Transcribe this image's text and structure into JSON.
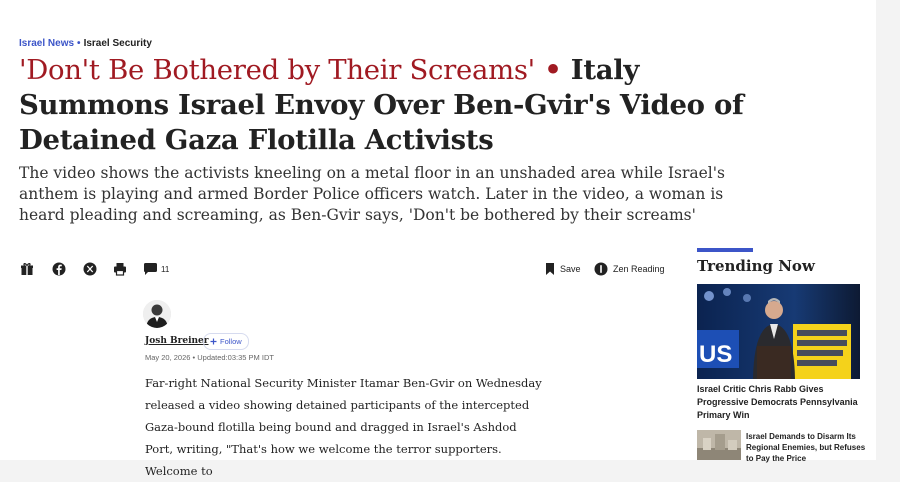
{
  "breadcrumb": {
    "section": "Israel News",
    "separator": "•",
    "subsection": "Israel Security"
  },
  "headline": {
    "quote": "'Don't Be Bothered by Their Screams'",
    "bullet": "•",
    "title": "Italy Summons Israel Envoy Over Ben-Gvir's Video of Detained Gaza Flotilla Activists"
  },
  "subhead": "The video shows the activists kneeling on a metal floor in an unshaded area while Israel's anthem is playing and armed Border Police officers watch. Later in the video, a woman is heard pleading and screaming, as Ben-Gvir says, 'Don't be bothered by their screams'",
  "toolbar": {
    "comment_count": "11",
    "save_label": "Save",
    "zen_label": "Zen Reading",
    "icons": [
      "gift-icon",
      "facebook-icon",
      "x-icon",
      "print-icon",
      "comment-icon",
      "bookmark-icon",
      "zen-reading-icon"
    ]
  },
  "author": {
    "name": "Josh Breiner",
    "follow_label": "Follow",
    "date": "May 20, 2026 • Updated:03:35 PM IDT"
  },
  "body": "Far-right National Security Minister Itamar Ben-Gvir on Wednesday released a video showing detained participants of the intercepted Gaza-bound flotilla being bound and dragged in Israel's Ashdod Port, writing, \"That's how we welcome the terror supporters. Welcome to",
  "trending": {
    "title": "Trending Now",
    "items": [
      {
        "title": "Israel Critic Chris Rabb Gives Progressive Democrats Pennsylvania Primary Win"
      },
      {
        "title": "Israel Demands to Disarm Its Regional Enemies, but Refuses to Pay the Price"
      }
    ],
    "image_text": "US"
  },
  "colors": {
    "accent": "#3c55c8",
    "quote": "#a01a22",
    "text": "#222222"
  }
}
